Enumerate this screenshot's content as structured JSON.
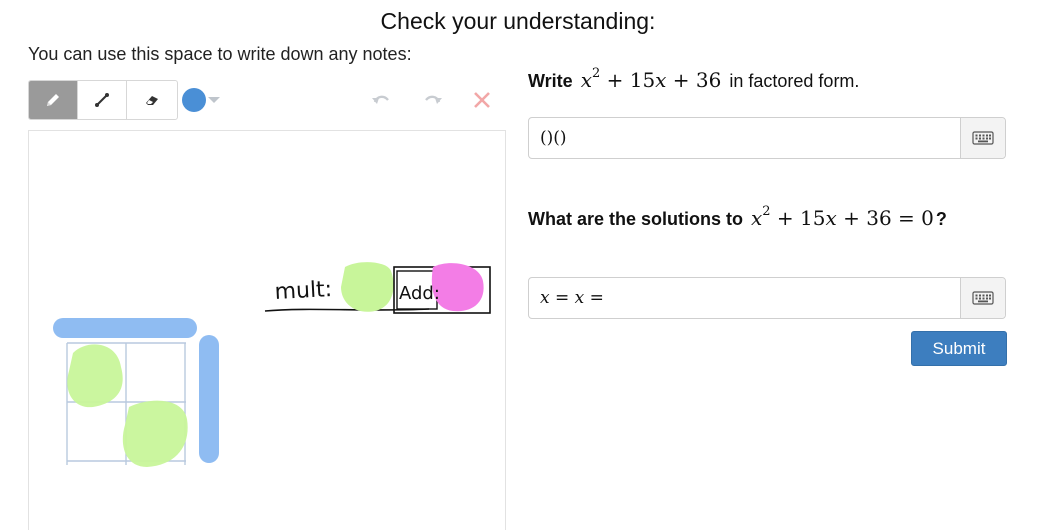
{
  "header": {
    "title": "Check your understanding:",
    "notes_label": "You can use this space to write down any notes:"
  },
  "toolbar": {
    "tools": [
      {
        "name": "pencil-icon",
        "active": true
      },
      {
        "name": "line-icon",
        "active": false
      },
      {
        "name": "eraser-icon",
        "active": false
      }
    ],
    "color": "#4a8fd6",
    "actions": [
      "undo-icon",
      "redo-icon",
      "clear-icon"
    ]
  },
  "canvas": {
    "handwriting": [
      "mult:",
      "Add:"
    ],
    "colors": {
      "blue": "#8fbcf2",
      "green": "#c8f59a",
      "pink": "#f37de6"
    }
  },
  "question1": {
    "prefix": "Write",
    "suffix": "in factored form.",
    "answer_value": "()()"
  },
  "question2": {
    "prefix": "What are the solutions to",
    "suffix": "?",
    "answer_value": "x = x ="
  },
  "submit": {
    "label": "Submit",
    "color": "#3d7ebf"
  }
}
